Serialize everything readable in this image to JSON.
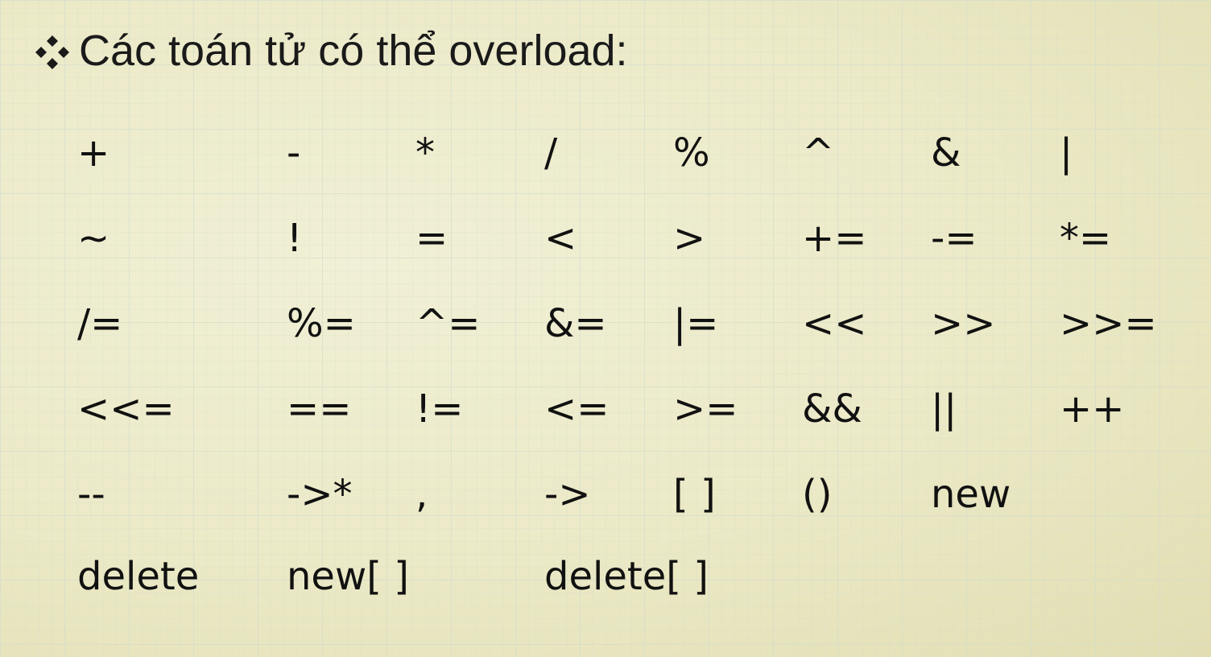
{
  "title": {
    "bullet_icon": "four-diamond-bullet-icon",
    "text": "Các toán tử có thể overload:"
  },
  "colors": {
    "background": "#ecebc9",
    "text": "#111111"
  },
  "operators": [
    [
      "+",
      "-",
      "*",
      "/",
      "%",
      "^",
      "&",
      "|"
    ],
    [
      "~",
      "!",
      "=",
      "<",
      ">",
      "+=",
      "-=",
      "*="
    ],
    [
      "/=",
      "%=",
      "^=",
      "&=",
      "|=",
      "<<",
      ">>",
      ">>="
    ],
    [
      "<<=",
      "==",
      "!=",
      "<=",
      ">=",
      "&&",
      "||",
      "++"
    ],
    [
      "--",
      "->*",
      ",",
      "->",
      "[ ]",
      "()",
      "new",
      ""
    ],
    [
      "delete",
      "new[ ]",
      "",
      "delete[ ]",
      "",
      "",
      "",
      ""
    ]
  ]
}
